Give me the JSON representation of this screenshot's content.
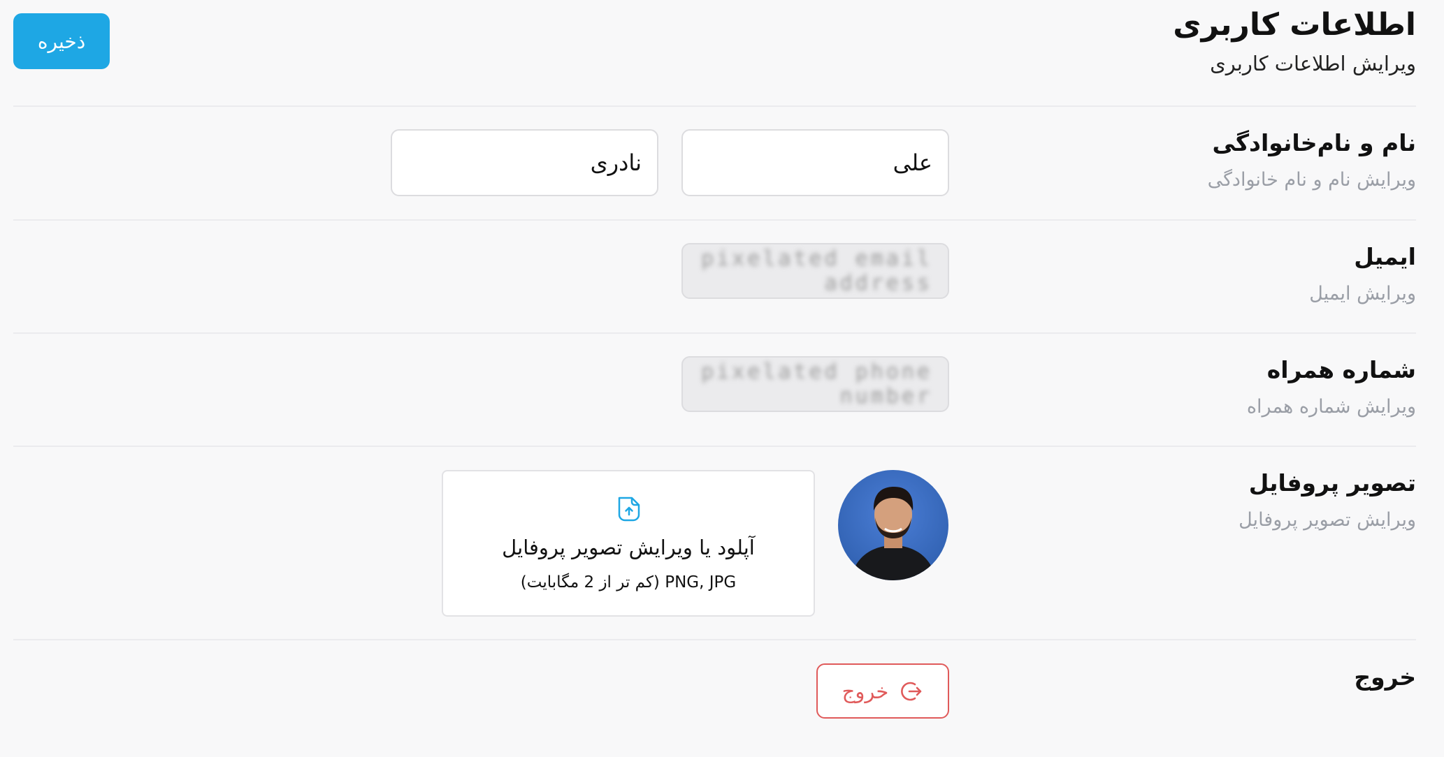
{
  "header": {
    "title": "اطلاعات کاربری",
    "subtitle": "ویرایش اطلاعات کاربری",
    "save_label": "ذخیره"
  },
  "sections": {
    "name": {
      "title": "نام و نام‌خانوادگی",
      "subtitle": "ویرایش نام و نام خانوادگی",
      "first_name": "علی",
      "last_name": "نادری"
    },
    "email": {
      "title": "ایمیل",
      "subtitle": "ویرایش ایمیل",
      "value": "pixelated email address"
    },
    "phone": {
      "title": "شماره همراه",
      "subtitle": "ویرایش شماره همراه",
      "value": "pixelated phone number"
    },
    "avatar": {
      "title": "تصویر پروفایل",
      "subtitle": "ویرایش تصویر پروفایل",
      "upload_label": "آپلود یا ویرایش تصویر پروفایل",
      "upload_hint": "PNG, JPG (کم تر از 2 مگابایت)"
    },
    "logout": {
      "title": "خروج",
      "button_label": "خروج"
    }
  },
  "colors": {
    "accent": "#1ea7e4",
    "danger": "#e05a5a",
    "background": "#f8f8f9"
  },
  "icons": {
    "upload": "file-upload-icon",
    "logout": "logout-icon"
  }
}
